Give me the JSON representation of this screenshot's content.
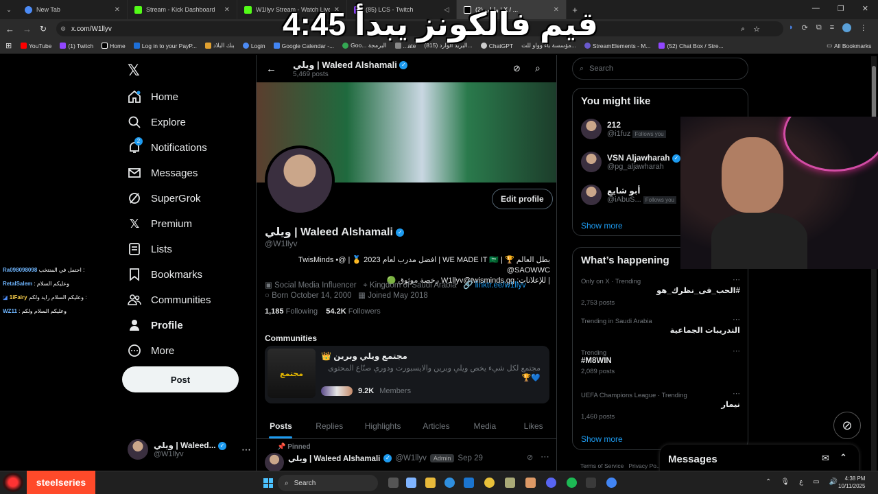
{
  "browser": {
    "tabs": [
      {
        "title": "New Tab",
        "color": "#4c8bf5"
      },
      {
        "title": "Stream - Kick Dashboard",
        "color": "#53fc18"
      },
      {
        "title": "W1llyv Stream - Watch Live on",
        "color": "#53fc18"
      },
      {
        "title": "(85) LCS - Twitch",
        "color": "#9146ff"
      },
      {
        "title": "(2) وليلي | X / ...",
        "color": "#ffffff"
      }
    ],
    "url": "x.com/W1llyv",
    "bookmarks": [
      "YouTube",
      "(1) Twitch",
      "Home",
      "Log in to your PayP...",
      "بنك البلاد",
      "Login",
      "Google Calendar -...",
      "Goo... البرمجة",
      "...ate",
      "البريد الوارد (815)...",
      "ChatGPT",
      "مؤسسة باء وواو للت...",
      "StreamElements - M...",
      "(52) Chat Box / Stre...",
      "All Bookmarks"
    ]
  },
  "overlay_text": "قيم فالكونز يبدأ 4:45",
  "chat": [
    {
      "user": "Ra098098098",
      "msg": "احتمل في المنتخب :"
    },
    {
      "user": "RetalSalem",
      "msg": ": وعليكم السلام"
    },
    {
      "user": "1iFairy",
      "msg": "وعليكم السلام رايد ولكم :"
    },
    {
      "user": "WZ11",
      "msg": ": وعليكم السلام ولكم"
    }
  ],
  "nav": {
    "items": [
      "Home",
      "Explore",
      "Notifications",
      "Messages",
      "SuperGrok",
      "Premium",
      "Lists",
      "Bookmarks",
      "Communities",
      "Profile",
      "More"
    ],
    "notif_count": "2",
    "post_label": "Post",
    "me_name": "ويلي | Waleed...",
    "me_handle": "@W1llyv"
  },
  "profile": {
    "name": "ويلي | Waleed Alshamali",
    "posts_count": "5,469 posts",
    "handle": "@W1llyv",
    "edit_label": "Edit profile",
    "bio_line1": "بطل العالم 🏆 | WE MADE IT 🇸🇦 | افضل مدرب لعام 2023 🥇 | @TwisMinds • @SAOWWC",
    "bio_line2": "| للإعلانات: W1llyv@twisminds.gg رخصة موثوق 🟢",
    "category": "Social Media Influencer",
    "location": "Kingdom of Saudi Arabia",
    "link": "linktr.ee/w1llyv",
    "born": "Born October 14, 2000",
    "joined": "Joined May 2018",
    "following_count": "1,185",
    "following_label": "Following",
    "followers_count": "54.2K",
    "followers_label": "Followers",
    "communities_header": "Communities",
    "community_name": "مجتمع ويلي وبرين 👑",
    "community_desc": "مجتمع لكل شيء يخص ويلي وبرين والايسبورت ودوري صنّاع المحتوى 💙🏆",
    "community_members": "9.2K",
    "members_label": "Members",
    "tabs": [
      "Posts",
      "Replies",
      "Highlights",
      "Articles",
      "Media",
      "Likes"
    ],
    "pinned_label": "Pinned",
    "pinned_name": "ويلي | Waleed Alshamali",
    "pinned_handle": "@W1llyv",
    "admin_label": "Admin",
    "pinned_date": "Sep 29"
  },
  "right": {
    "search_placeholder": "Search",
    "you_might_like": "You might like",
    "suggestions": [
      {
        "name": "212",
        "handle": "@i1fuz",
        "follows_you": "Follows you"
      },
      {
        "name": "VSN Aljawharah",
        "handle": "@pg_aljawharah",
        "follows_you": ""
      },
      {
        "name": "أبو شايع",
        "handle": "@iAbuS...",
        "follows_you": "Follows you"
      }
    ],
    "show_more": "Show more",
    "whats_happening": "What’s happening",
    "trends": [
      {
        "context": "Only on X · Trending",
        "title": "#الحب_فى_نظرك_هو",
        "count": "2,753 posts"
      },
      {
        "context": "Trending in Saudi Arabia",
        "title": "التدريبات الجماعية",
        "count": ""
      },
      {
        "context": "Trending",
        "title": "#M8WIN",
        "count": "2,089 posts"
      },
      {
        "context": "UEFA Champions League · Trending",
        "title": "نيمار",
        "count": "1,460 posts"
      }
    ],
    "footer": [
      "Terms of Service",
      "Privacy Po..."
    ]
  },
  "messages_label": "Messages",
  "taskbar": {
    "brand": "steelseries",
    "search": "Search",
    "time": "4:38 PM",
    "date": "10/11/2025"
  }
}
